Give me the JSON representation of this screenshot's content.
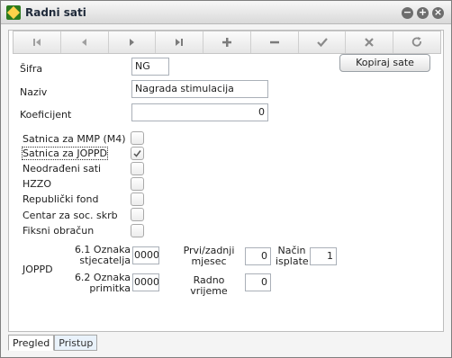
{
  "window": {
    "title": "Radni sati"
  },
  "toolbar": {
    "buttons": [
      {
        "name": "first-record-button",
        "icon": "first-icon"
      },
      {
        "name": "previous-record-button",
        "icon": "previous-icon"
      },
      {
        "name": "next-record-button",
        "icon": "next-icon"
      },
      {
        "name": "last-record-button",
        "icon": "last-icon"
      },
      {
        "name": "add-button",
        "icon": "plus-icon"
      },
      {
        "name": "delete-button",
        "icon": "minus-icon"
      },
      {
        "name": "confirm-button",
        "icon": "check-icon"
      },
      {
        "name": "cancel-button",
        "icon": "close-icon"
      },
      {
        "name": "refresh-button",
        "icon": "refresh-icon"
      }
    ]
  },
  "form": {
    "sifra_label": "Šifra",
    "sifra_value": "NG",
    "naziv_label": "Naziv",
    "naziv_value": "Nagrada stimulacija",
    "koeficijent_label": "Koeficijent",
    "koeficijent_value": "0",
    "copy_button": "Kopiraj sate"
  },
  "checkboxes": [
    {
      "label": "Satnica za MMP (M4)",
      "checked": false
    },
    {
      "label": "Satnica za JOPPD",
      "checked": true
    },
    {
      "label": "Neodrađeni sati",
      "checked": false
    },
    {
      "label": "HZZO",
      "checked": false
    },
    {
      "label": "Republički fond",
      "checked": false
    },
    {
      "label": "Centar za soc. skrb",
      "checked": false
    },
    {
      "label": "Fiksni obračun",
      "checked": false
    }
  ],
  "joppd": {
    "label": "JOPPD",
    "oznaka_stjecatelja_label_1": "6.1 Oznaka",
    "oznaka_stjecatelja_label_2": "stjecatelja",
    "oznaka_stjecatelja_value": "0000",
    "oznaka_primitka_label_1": "6.2 Oznaka",
    "oznaka_primitka_label_2": "primitka",
    "oznaka_primitka_value": "0000",
    "prvi_zadnji_label_1": "Prvi/zadnji",
    "prvi_zadnji_label_2": "mjesec",
    "prvi_zadnji_value": "0",
    "radno_vrijeme_label": "Radno vrijeme",
    "radno_vrijeme_value": "0",
    "nacin_isplate_label_1": "Način",
    "nacin_isplate_label_2": "isplate",
    "nacin_isplate_value": "1"
  },
  "tabs": [
    {
      "label": "Pregled",
      "active": true
    },
    {
      "label": "Pristup",
      "active": false
    }
  ]
}
